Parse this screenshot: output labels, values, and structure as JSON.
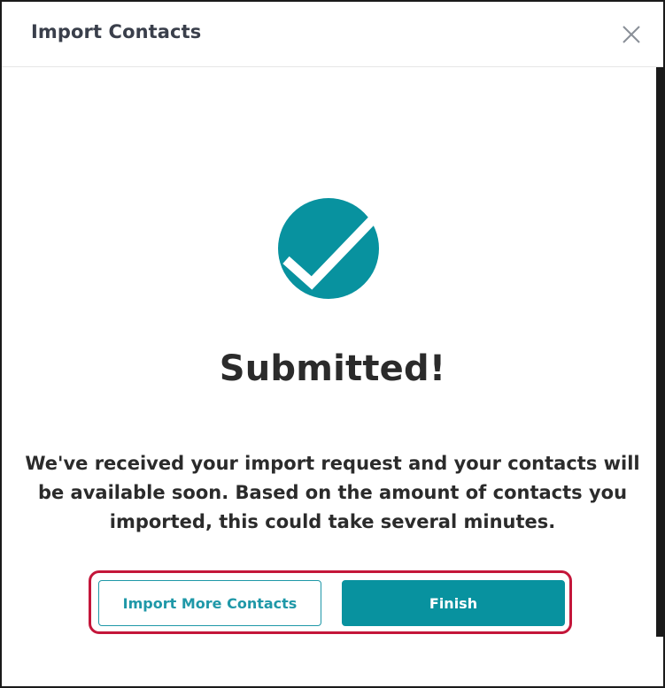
{
  "modal": {
    "title": "Import Contacts",
    "close_icon": "close-icon",
    "success_icon": "checkmark-circle-icon",
    "heading": "Submitted!",
    "message": "We've received your import request and your contacts will be available soon. Based on the amount of contacts you imported, this could take several minutes.",
    "buttons": {
      "import_more_label": "Import More Contacts",
      "finish_label": "Finish"
    }
  },
  "colors": {
    "accent": "#08929f",
    "highlight_border": "#c4163a",
    "text_dark": "#2b2b2b"
  }
}
